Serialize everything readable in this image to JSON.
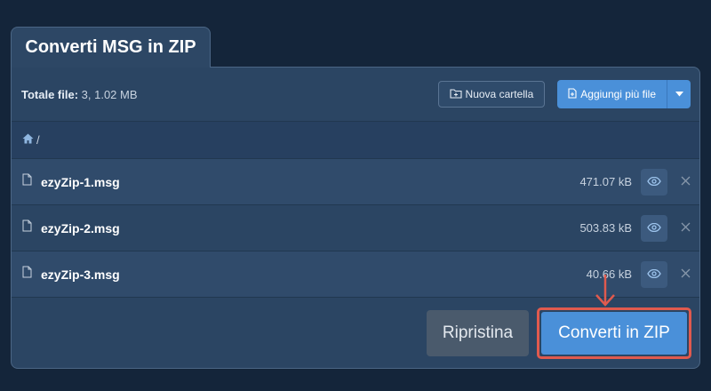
{
  "tab": {
    "title": "Converti MSG in ZIP"
  },
  "toolbar": {
    "total_label": "Totale file:",
    "total_value": " 3, 1.02 MB",
    "new_folder_label": "Nuova cartella",
    "add_more_label": "Aggiungi più file"
  },
  "breadcrumb": {
    "separator": "/"
  },
  "files": [
    {
      "name": "ezyZip-1.msg",
      "size": "471.07 kB"
    },
    {
      "name": "ezyZip-2.msg",
      "size": "503.83 kB"
    },
    {
      "name": "ezyZip-3.msg",
      "size": "40.66 kB"
    }
  ],
  "actions": {
    "reset_label": "Ripristina",
    "convert_label": "Converti in ZIP"
  },
  "colors": {
    "accent": "#4a90d9",
    "highlight": "#e05a4e",
    "panel": "#2b4563",
    "background": "#14253a"
  },
  "icons": [
    "folder-plus-icon",
    "file-plus-icon",
    "caret-down-icon",
    "home-icon",
    "file-icon",
    "eye-icon",
    "close-icon",
    "arrow-down-icon"
  ]
}
